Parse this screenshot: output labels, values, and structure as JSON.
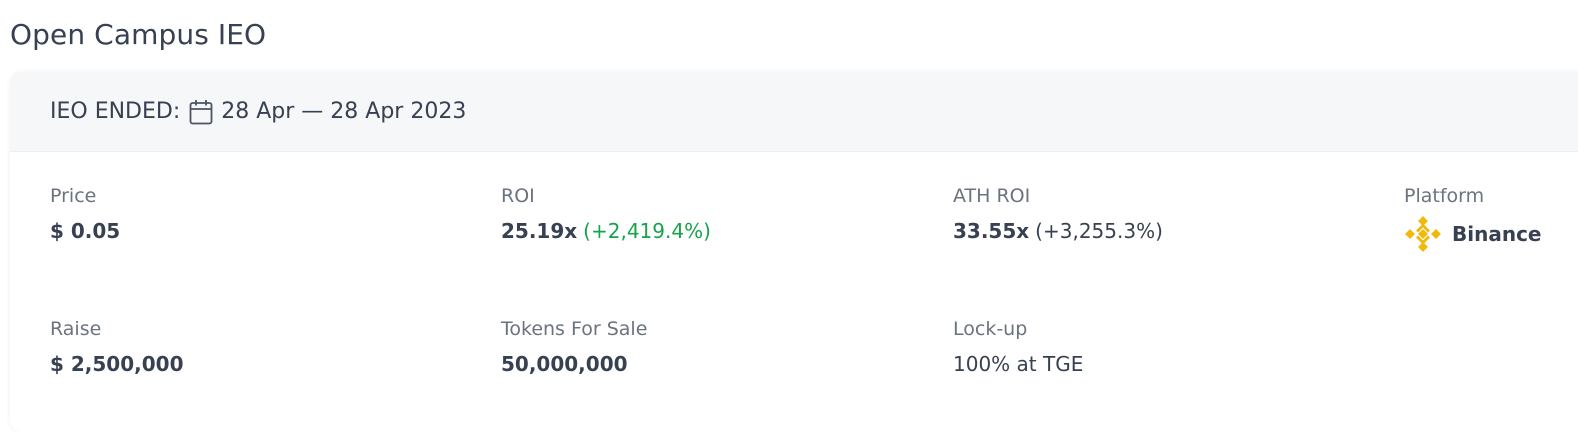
{
  "page": {
    "title": "Open Campus IEO"
  },
  "header": {
    "status": "IEO ENDED:",
    "dates": "28 Apr — 28 Apr 2023"
  },
  "stats": {
    "price": {
      "label": "Price",
      "value": "$ 0.05"
    },
    "roi": {
      "label": "ROI",
      "value": "25.19x",
      "change": "(+2,419.4%)"
    },
    "ath_roi": {
      "label": "ATH ROI",
      "value": "33.55x",
      "change": "(+3,255.3%)"
    },
    "platform": {
      "label": "Platform",
      "value": "Binance",
      "icon": "binance-logo-icon"
    },
    "raise": {
      "label": "Raise",
      "value": "$ 2,500,000"
    },
    "tokens_for_sale": {
      "label": "Tokens For Sale",
      "value": "50,000,000"
    },
    "lockup": {
      "label": "Lock-up",
      "value": "100% at TGE"
    }
  },
  "colors": {
    "positive": "#16a34a",
    "binance": "#F0B90B"
  }
}
